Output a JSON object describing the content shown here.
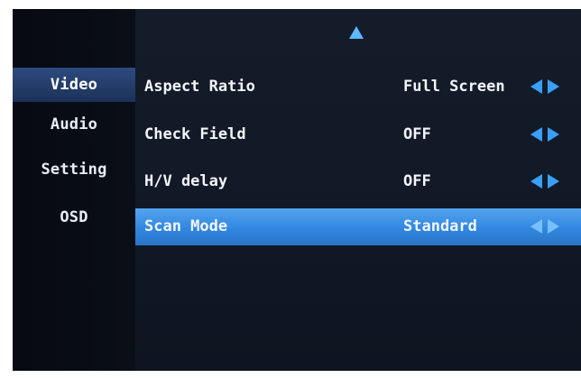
{
  "osd": {
    "up_arrow_icon": "triangle-up-icon",
    "sidebar": [
      {
        "label": "Video",
        "active": true
      },
      {
        "label": "Audio",
        "active": false
      },
      {
        "label": "Setting",
        "active": false
      },
      {
        "label": "OSD",
        "active": false
      }
    ],
    "rows": [
      {
        "label": "Aspect Ratio",
        "value": "Full Screen",
        "selected": false
      },
      {
        "label": "Check Field",
        "value": "OFF",
        "selected": false
      },
      {
        "label": "H/V delay",
        "value": "OFF",
        "selected": false
      },
      {
        "label": "Scan Mode",
        "value": "Standard",
        "selected": true
      }
    ],
    "colors": {
      "accent": "#3a8fe6",
      "arrow": "#3aa0ff",
      "background": "#0b0f1a"
    }
  }
}
